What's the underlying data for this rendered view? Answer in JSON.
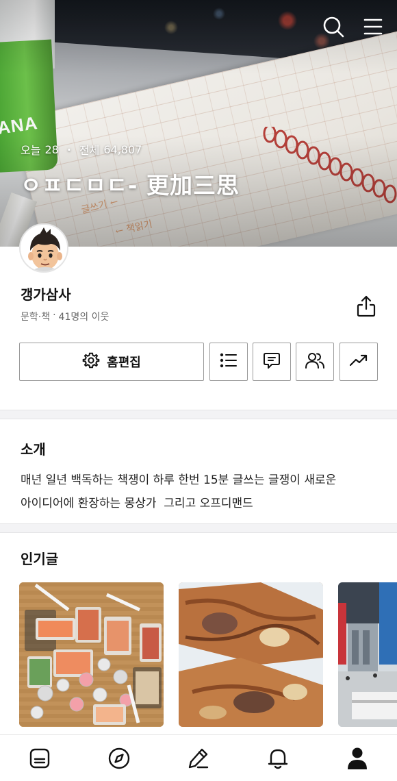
{
  "header": {
    "stats": {
      "today_label": "오늘",
      "today_count": "28",
      "separator": "·",
      "total_label": "전체",
      "total_count": "64,807"
    },
    "blog_title": "ㅇㅍㄷㅁㄷ- 更加三思",
    "icons": [
      "search-icon",
      "menu-icon"
    ]
  },
  "profile": {
    "nickname": "갱가삼사",
    "category": "문학·책",
    "separator": "·",
    "neighbors": "41명의 이웃",
    "share_icon": "share-icon"
  },
  "actions": {
    "edit_label": "홈편집",
    "edit_icon": "gear-icon",
    "icon_buttons": [
      "list-icon",
      "comment-icon",
      "neighbors-icon",
      "stats-trend-icon"
    ]
  },
  "intro": {
    "title": "소개",
    "text": "매년 일년 백독하는 책쟁이 하루 한번 15분 글쓰는 글쟁이 새로운\n아이디어에 환장하는 몽상가  그리고 오프디맨드"
  },
  "popular": {
    "title": "인기글",
    "thumbnails": [
      "sushi-platter-photo",
      "bread-photo",
      "warehouse-store-photo"
    ]
  },
  "bottom_nav": {
    "items": [
      "feed-icon",
      "compass-icon",
      "write-icon",
      "bell-icon",
      "profile-icon"
    ],
    "active": "profile-icon"
  },
  "colors": {
    "accent": "#111111",
    "border": "#9a9a9a",
    "separator": "#f3f3f5"
  }
}
